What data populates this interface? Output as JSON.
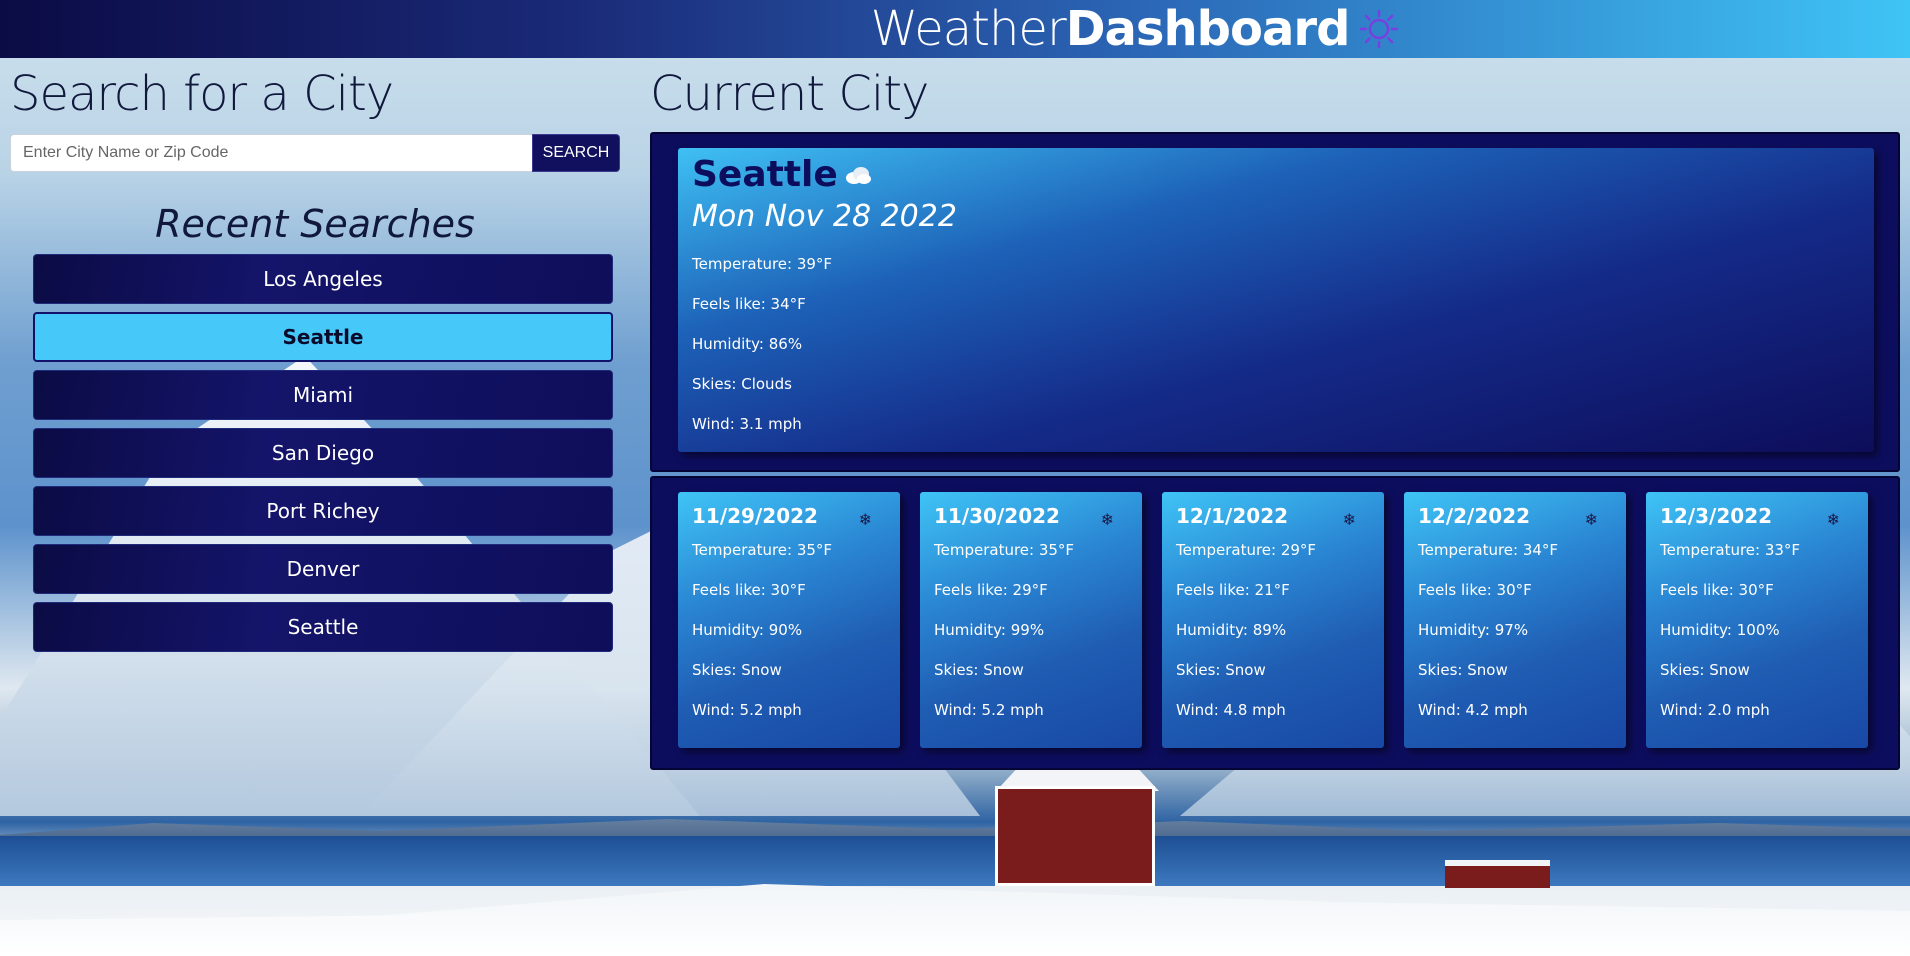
{
  "header": {
    "brand_light": "Weather",
    "brand_bold": "Dashboard",
    "brand_icon": "sun-icon"
  },
  "search": {
    "heading": "Search for a City",
    "placeholder": "Enter City Name or Zip Code",
    "value": "",
    "button_label": "SEARCH"
  },
  "recent": {
    "heading": "Recent Searches",
    "items": [
      {
        "label": "Los Angeles",
        "active": false
      },
      {
        "label": "Seattle",
        "active": true
      },
      {
        "label": "Miami",
        "active": false
      },
      {
        "label": "San Diego",
        "active": false
      },
      {
        "label": "Port Richey",
        "active": false
      },
      {
        "label": "Denver",
        "active": false
      },
      {
        "label": "Seattle",
        "active": false
      }
    ]
  },
  "current": {
    "heading": "Current City",
    "city": "Seattle",
    "icon": "cloud-icon",
    "date": "Mon Nov 28 2022",
    "temperature": "Temperature: 39°F",
    "feels_like": "Feels like: 34°F",
    "humidity": "Humidity: 86%",
    "skies": "Skies: Clouds",
    "wind": "Wind: 3.1 mph"
  },
  "forecast": [
    {
      "date": "11/29/2022",
      "icon": "snowflake-icon",
      "temperature": "Temperature: 35°F",
      "feels_like": "Feels like: 30°F",
      "humidity": "Humidity: 90%",
      "skies": "Skies: Snow",
      "wind": "Wind: 5.2 mph"
    },
    {
      "date": "11/30/2022",
      "icon": "snowflake-icon",
      "temperature": "Temperature: 35°F",
      "feels_like": "Feels like: 29°F",
      "humidity": "Humidity: 99%",
      "skies": "Skies: Snow",
      "wind": "Wind: 5.2 mph"
    },
    {
      "date": "12/1/2022",
      "icon": "snowflake-icon",
      "temperature": "Temperature: 29°F",
      "feels_like": "Feels like: 21°F",
      "humidity": "Humidity: 89%",
      "skies": "Skies: Snow",
      "wind": "Wind: 4.8 mph"
    },
    {
      "date": "12/2/2022",
      "icon": "snowflake-icon",
      "temperature": "Temperature: 34°F",
      "feels_like": "Feels like: 30°F",
      "humidity": "Humidity: 97%",
      "skies": "Skies: Snow",
      "wind": "Wind: 4.2 mph"
    },
    {
      "date": "12/3/2022",
      "icon": "snowflake-icon",
      "temperature": "Temperature: 33°F",
      "feels_like": "Feels like: 30°F",
      "humidity": "Humidity: 100%",
      "skies": "Skies: Snow",
      "wind": "Wind: 2.0 mph"
    }
  ],
  "colors": {
    "navy": "#0d0d5e",
    "accent": "#46c8f8",
    "header_start": "#0b0b45",
    "header_end": "#3fc4f6"
  }
}
